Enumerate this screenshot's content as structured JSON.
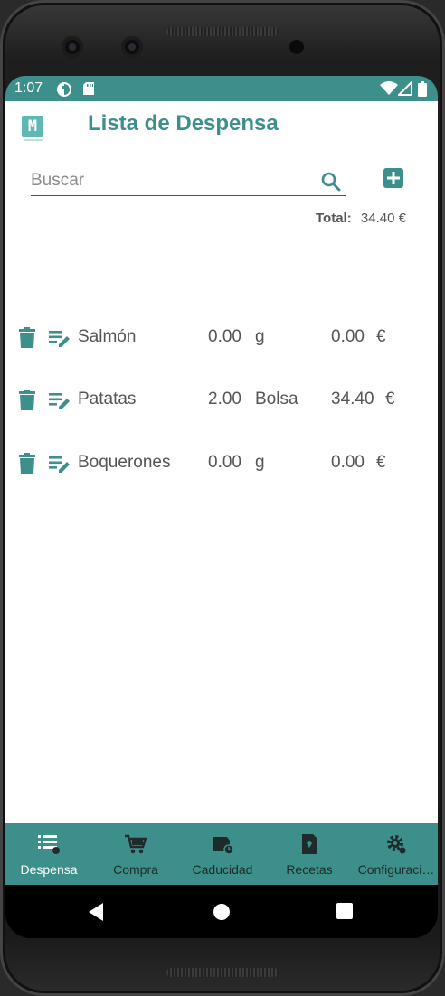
{
  "status": {
    "time": "1:07"
  },
  "header": {
    "title": "Lista de Despensa"
  },
  "search": {
    "placeholder": "Buscar",
    "value": ""
  },
  "total": {
    "label": "Total:",
    "value": "34.40 €"
  },
  "items": [
    {
      "name": "Salmón",
      "quantity": "0.00",
      "unit": "g",
      "price": "0.00",
      "currency": "€"
    },
    {
      "name": "Patatas",
      "quantity": "2.00",
      "unit": "Bolsa",
      "price": "34.40",
      "currency": "€"
    },
    {
      "name": "Boquerones",
      "quantity": "0.00",
      "unit": "g",
      "price": "0.00",
      "currency": "€"
    }
  ],
  "nav": [
    {
      "label": "Despensa",
      "icon": "list-icon",
      "active": true
    },
    {
      "label": "Compra",
      "icon": "cart-icon",
      "active": false
    },
    {
      "label": "Caducidad",
      "icon": "expiry-icon",
      "active": false
    },
    {
      "label": "Recetas",
      "icon": "recipe-icon",
      "active": false
    },
    {
      "label": "Configuraci…",
      "icon": "settings-icon",
      "active": false
    }
  ],
  "colors": {
    "primary": "#3d8f8b",
    "text": "#555555"
  }
}
